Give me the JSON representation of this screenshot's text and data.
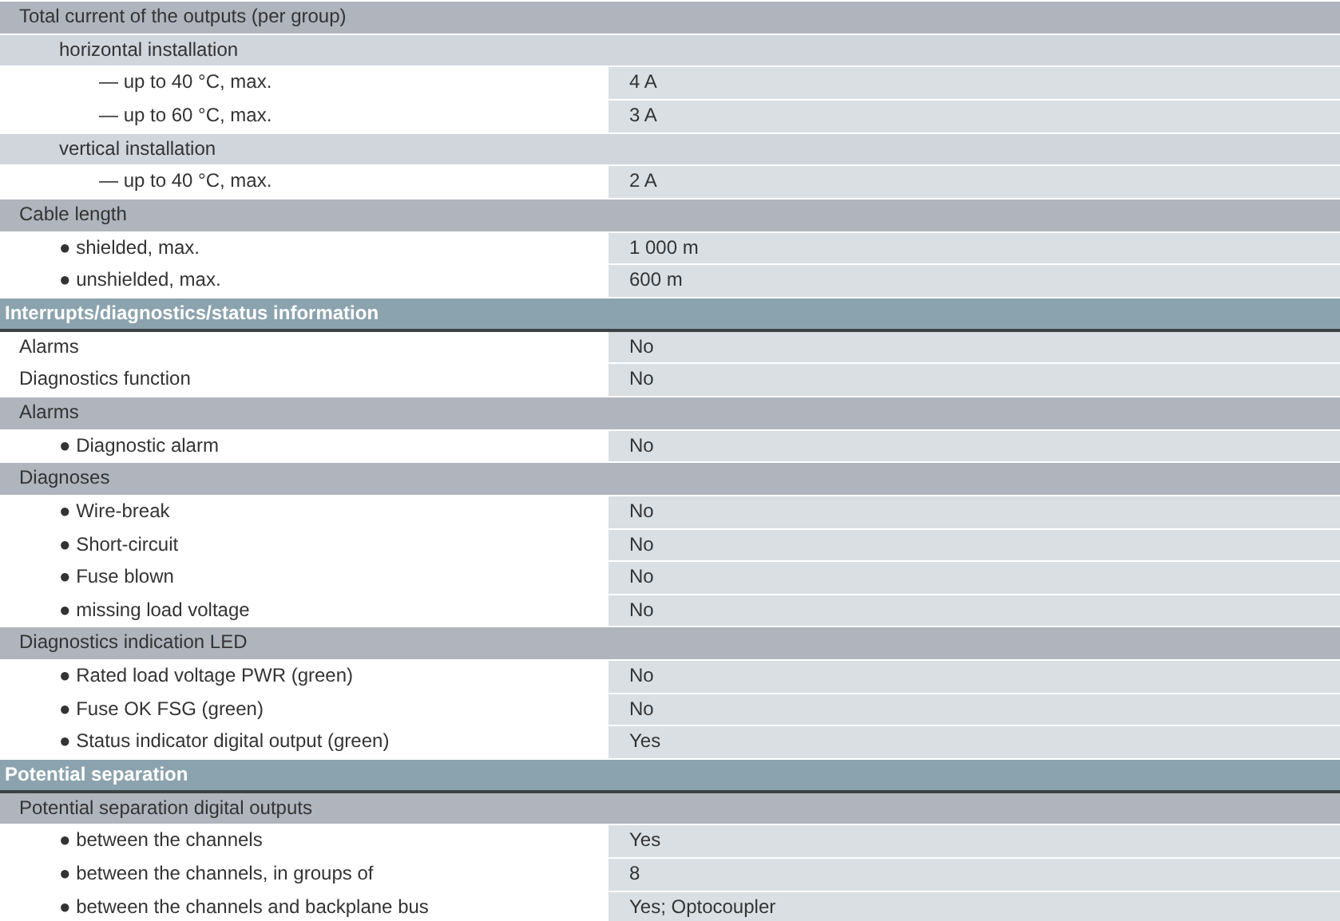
{
  "rows": [
    {
      "kind": "group",
      "label": "Total current of the outputs (per group)",
      "children": [
        {
          "kind": "group",
          "label": "horizontal installation",
          "children": [
            {
              "kind": "item",
              "label": "— up to 40 °C, max.",
              "value": "4 A"
            },
            {
              "kind": "item",
              "label": "— up to 60 °C, max.",
              "value": "3 A"
            }
          ]
        },
        {
          "kind": "group",
          "label": "vertical installation",
          "children": [
            {
              "kind": "item",
              "label": "— up to 40 °C, max.",
              "value": "2 A"
            }
          ]
        }
      ]
    },
    {
      "kind": "group",
      "label": "Cable length",
      "children": [
        {
          "kind": "item",
          "label": "● shielded, max.",
          "value": "1 000 m"
        },
        {
          "kind": "item",
          "label": "● unshielded, max.",
          "value": "600 m"
        }
      ]
    },
    {
      "kind": "section",
      "label": "Interrupts/diagnostics/status information",
      "children": [
        {
          "kind": "item",
          "label": "Alarms",
          "value": "No"
        },
        {
          "kind": "item",
          "label": "Diagnostics function",
          "value": "No"
        },
        {
          "kind": "group",
          "label": "Alarms",
          "children": [
            {
              "kind": "item",
              "label": "● Diagnostic alarm",
              "value": "No"
            }
          ]
        },
        {
          "kind": "group",
          "label": "Diagnoses",
          "children": [
            {
              "kind": "item",
              "label": "● Wire-break",
              "value": "No"
            },
            {
              "kind": "item",
              "label": "● Short-circuit",
              "value": "No"
            },
            {
              "kind": "item",
              "label": "● Fuse blown",
              "value": "No"
            },
            {
              "kind": "item",
              "label": "● missing load voltage",
              "value": "No"
            }
          ]
        },
        {
          "kind": "group",
          "label": "Diagnostics indication LED",
          "children": [
            {
              "kind": "item",
              "label": "● Rated load voltage PWR (green)",
              "value": "No"
            },
            {
              "kind": "item",
              "label": "● Fuse OK FSG (green)",
              "value": "No"
            },
            {
              "kind": "item",
              "label": "● Status indicator digital output (green)",
              "value": "Yes"
            }
          ]
        }
      ]
    },
    {
      "kind": "section",
      "label": "Potential separation",
      "children": [
        {
          "kind": "group",
          "label": "Potential separation digital outputs",
          "children": [
            {
              "kind": "item",
              "label": "● between the channels",
              "value": "Yes"
            },
            {
              "kind": "item",
              "label": "● between the channels, in groups of",
              "value": "8"
            },
            {
              "kind": "item",
              "label": "● between the channels and backplane bus",
              "value": "Yes; Optocoupler"
            }
          ]
        }
      ]
    }
  ]
}
